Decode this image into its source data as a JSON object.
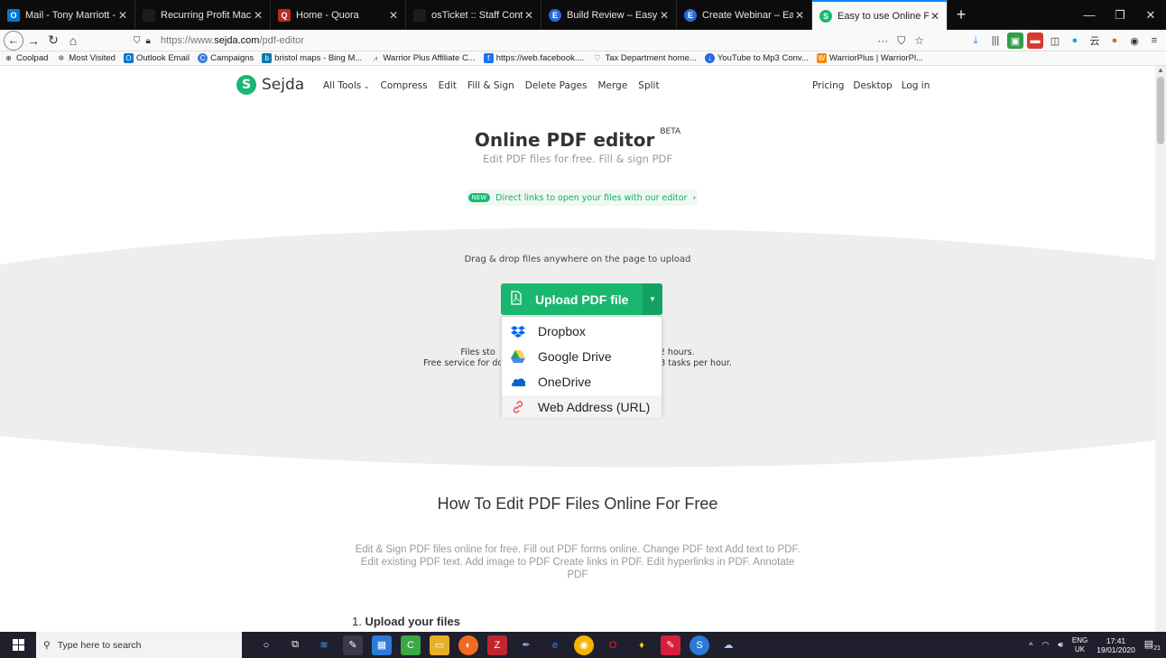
{
  "browser": {
    "tabs": [
      {
        "title": "Mail - Tony Marriott - Outlook",
        "favicon": "outlook-icon",
        "color": "#0078d4"
      },
      {
        "title": "Recurring Profit Machine JV",
        "favicon": "page-icon",
        "color": "#555555"
      },
      {
        "title": "Home - Quora",
        "favicon": "quora-icon",
        "color": "#b92b27"
      },
      {
        "title": "osTicket :: Staff Control Panel",
        "favicon": "page-icon",
        "color": "#555555"
      },
      {
        "title": "Build Review – Easy Pro Review",
        "favicon": "easypro-icon",
        "color": "#2a6ad8"
      },
      {
        "title": "Create Webinar – Easy Pro Web",
        "favicon": "easypro-icon",
        "color": "#2a6ad8"
      },
      {
        "title": "Easy to use Online PDF editor",
        "favicon": "sejda-icon",
        "color": "#19b770"
      }
    ],
    "url_prefix": "https://www.",
    "url_domain": "sejda.com",
    "url_path": "/pdf-editor",
    "bookmarks": [
      {
        "label": "Coolpad",
        "icon": "globe-icon"
      },
      {
        "label": "Most Visited",
        "icon": "gear-icon"
      },
      {
        "label": "Outlook Email",
        "icon": "outlook-icon"
      },
      {
        "label": "Campaigns",
        "icon": "campaigns-icon"
      },
      {
        "label": "bristol maps - Bing M...",
        "icon": "bing-icon"
      },
      {
        "label": "Warrior Plus Affiliate C...",
        "icon": "warrior-icon"
      },
      {
        "label": "https://web.facebook....",
        "icon": "facebook-icon"
      },
      {
        "label": "Tax Department home...",
        "icon": "shield-icon"
      },
      {
        "label": "YouTube to Mp3 Conv...",
        "icon": "download-icon"
      },
      {
        "label": "WarriorPlus | WarriorPl...",
        "icon": "warriorplus-icon"
      }
    ]
  },
  "site": {
    "logo_text": "Sejda",
    "nav": [
      "All Tools",
      "Compress",
      "Edit",
      "Fill & Sign",
      "Delete Pages",
      "Merge",
      "Split"
    ],
    "right_nav": [
      "Pricing",
      "Desktop",
      "Log in"
    ],
    "title": "Online PDF editor",
    "title_badge": "BETA",
    "subtitle": "Edit PDF files for free. Fill & sign PDF",
    "new_badge": "NEW",
    "new_link": "Direct links to open your files with our editor",
    "drag_text": "Drag & drop files anywhere on the page to upload",
    "upload_label": "Upload PDF file",
    "files_note_line1_left": "Files sto",
    "files_note_line1_right": "2 hours.",
    "files_note_line2_left": "Free service for do",
    "files_note_line2_right": "d 3 tasks per hour.",
    "dropdown": [
      {
        "label": "Dropbox",
        "icon": "dropbox-icon"
      },
      {
        "label": "Google Drive",
        "icon": "google-drive-icon"
      },
      {
        "label": "OneDrive",
        "icon": "onedrive-icon"
      },
      {
        "label": "Web Address (URL)",
        "icon": "link-icon"
      }
    ],
    "howto_title": "How To Edit PDF Files Online For Free",
    "howto_desc": "Edit & Sign PDF files online for free. Fill out PDF forms online. Change PDF text Add text to PDF. Edit existing PDF text. Add image to PDF Create links in PDF. Edit hyperlinks in PDF. Annotate PDF",
    "step_num": "1.",
    "step_label": "Upload your files"
  },
  "taskbar": {
    "search_placeholder": "Type here to search",
    "lang_top": "ENG",
    "lang_bottom": "UK",
    "time": "17:41",
    "date": "19/01/2020",
    "notifications": "21"
  },
  "colors": {
    "accent": "#19b770",
    "accent_dark": "#14a262",
    "browser_active_tab": "#0a84ff"
  }
}
